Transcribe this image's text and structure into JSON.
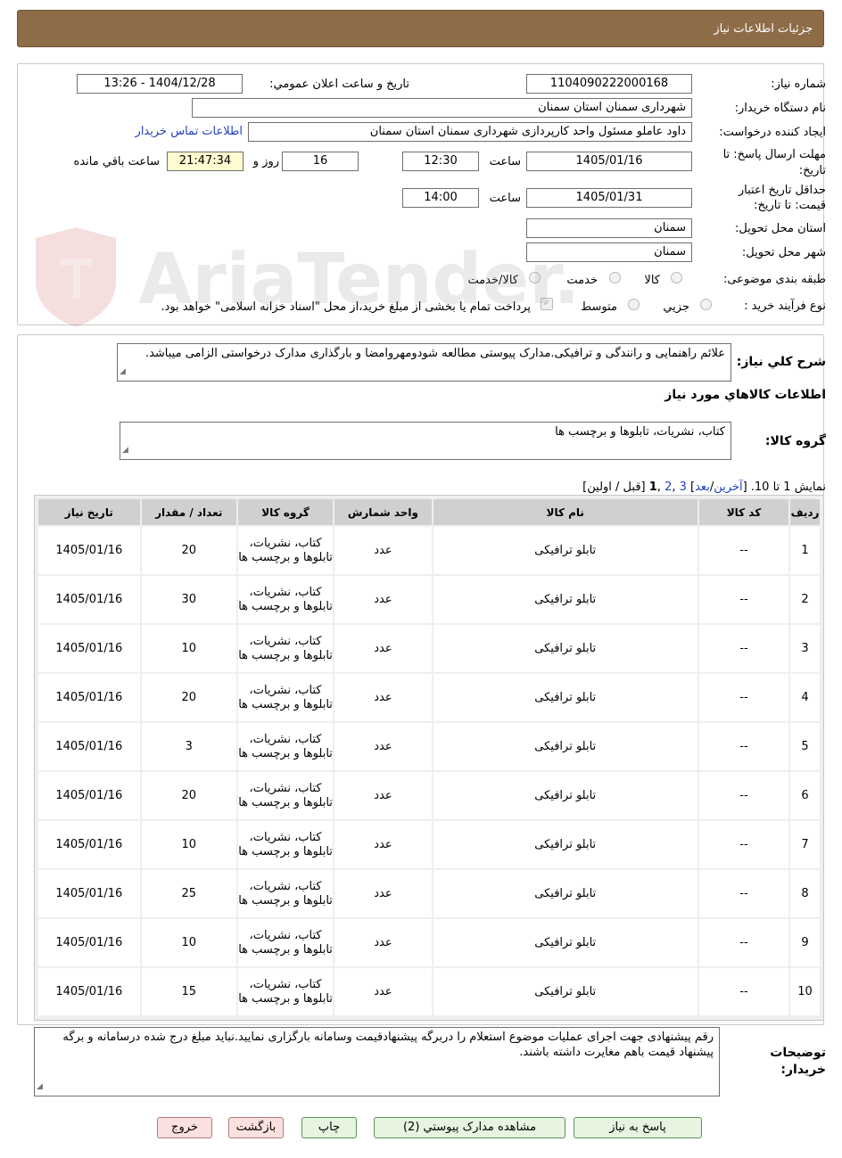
{
  "header": {
    "title": "جزئیات اطلاعات نیاز"
  },
  "info": {
    "need_number_label": "شماره نیاز:",
    "need_number": "1104090222000168",
    "announce_label": "تاریخ و ساعت اعلان عمومي:",
    "announce_value": "1404/12/28 - 13:26",
    "buyer_label": "نام دستگاه خریدار:",
    "buyer_value": "شهرداری سمنان استان سمنان",
    "requester_label": "ایجاد کننده درخواست:",
    "requester_value": "داود عاملو مسئول واحد کارپردازی شهرداری سمنان استان سمنان",
    "contact_link": "اطلاعات تماس خریدار",
    "deadline_label_1": "مهلت ارسال پاسخ: تا",
    "deadline_label_2": "تاریخ:",
    "deadline_date": "1405/01/16",
    "hour_label": "ساعت",
    "deadline_time": "12:30",
    "days_value": "16",
    "days_label": "روز و",
    "remaining_time": "21:47:34",
    "remaining_label": "ساعت باقي مانده",
    "validity_label_1": "حداقل تاریخ اعتبار",
    "validity_label_2": "قیمت: تا تاریخ:",
    "validity_date": "1405/01/31",
    "validity_hour_label": "ساعت",
    "validity_time": "14:00",
    "province_label": "استان محل تحویل:",
    "province_value": "سمنان",
    "city_label": "شهر محل تحویل:",
    "city_value": "سمنان",
    "category_label": "طبقه بندی موضوعی:",
    "category_options": [
      "کالا",
      "خدمت",
      "کالا/خدمت"
    ],
    "process_label": "نوع فرآیند خرید :",
    "process_options": [
      "جزیي",
      "متوسط"
    ],
    "payment_note": "پرداخت تمام یا بخشی از مبلغ خرید،از محل \"اسناد خزانه اسلامی\" خواهد بود."
  },
  "description": {
    "label": "شرح کلي نیاز:",
    "text": "علائم راهنمایی و رانندگی و ترافیکی.مدارک پیوستی مطالعه شودومهروامضا و بارگذاری مدارک درخواستی الزامی میباشد."
  },
  "goods": {
    "section_title": "اطلاعات کالاهاي مورد نیاز",
    "group_label": "گروه کالا:",
    "group_value": "کتاب، نشریات، تابلوها و برچسب ها"
  },
  "pagination": {
    "prefix": "نمایش 1 تا 10. [",
    "last": "آخرین",
    "sep1": "/",
    "next": "بعد",
    "mid": "] ",
    "p3": "3",
    "comma1": " ,",
    "p2": "2",
    "comma2": " ,",
    "p1": "1",
    "suffix": " [قبل / اولین]"
  },
  "table": {
    "headers": [
      "ردیف",
      "کد کالا",
      "نام کالا",
      "واحد شمارش",
      "گروه کالا",
      "تعداد / مقدار",
      "تاریخ نیاز"
    ],
    "rows": [
      [
        "1",
        "--",
        "تابلو ترافیکی",
        "عدد",
        "کتاب، نشریات، تابلوها و برچسب ها",
        "20",
        "1405/01/16"
      ],
      [
        "2",
        "--",
        "تابلو ترافیکی",
        "عدد",
        "کتاب، نشریات، تابلوها و برچسب ها",
        "30",
        "1405/01/16"
      ],
      [
        "3",
        "--",
        "تابلو ترافیکی",
        "عدد",
        "کتاب، نشریات، تابلوها و برچسب ها",
        "10",
        "1405/01/16"
      ],
      [
        "4",
        "--",
        "تابلو ترافیکی",
        "عدد",
        "کتاب، نشریات، تابلوها و برچسب ها",
        "20",
        "1405/01/16"
      ],
      [
        "5",
        "--",
        "تابلو ترافیکی",
        "عدد",
        "کتاب، نشریات، تابلوها و برچسب ها",
        "3",
        "1405/01/16"
      ],
      [
        "6",
        "--",
        "تابلو ترافیکی",
        "عدد",
        "کتاب، نشریات، تابلوها و برچسب ها",
        "20",
        "1405/01/16"
      ],
      [
        "7",
        "--",
        "تابلو ترافیکی",
        "عدد",
        "کتاب، نشریات، تابلوها و برچسب ها",
        "10",
        "1405/01/16"
      ],
      [
        "8",
        "--",
        "تابلو ترافیکی",
        "عدد",
        "کتاب، نشریات، تابلوها و برچسب ها",
        "25",
        "1405/01/16"
      ],
      [
        "9",
        "--",
        "تابلو ترافیکی",
        "عدد",
        "کتاب، نشریات، تابلوها و برچسب ها",
        "10",
        "1405/01/16"
      ],
      [
        "10",
        "--",
        "تابلو ترافیکی",
        "عدد",
        "کتاب، نشریات، تابلوها و برچسب ها",
        "15",
        "1405/01/16"
      ]
    ]
  },
  "buyer_notes": {
    "label_1": "توضیحات",
    "label_2": "خریدار:",
    "text": "رقم پیشنهادی جهت اجرای عملیات موضوع استعلام را دربرگه پیشنهادقیمت وسامانه بارگزاری نمایید.نباید مبلغ درج شده درسامانه و برگه پیشنهاد قیمت باهم مغایرت داشته باشند."
  },
  "buttons": {
    "reply": "پاسخ به نیاز",
    "attachments": "مشاهده مدارک پیوستي (2)",
    "print": "چاپ",
    "back": "بازگشت",
    "exit": "خروج"
  },
  "watermark": {
    "text": "AriaTender.neT"
  },
  "colors": {
    "header_bg": "#8d6c47",
    "link": "#1f3fc7",
    "button_green": "#e6f4e0",
    "button_pink": "#fbe0e0",
    "timer_bg": "#fffbd0"
  }
}
